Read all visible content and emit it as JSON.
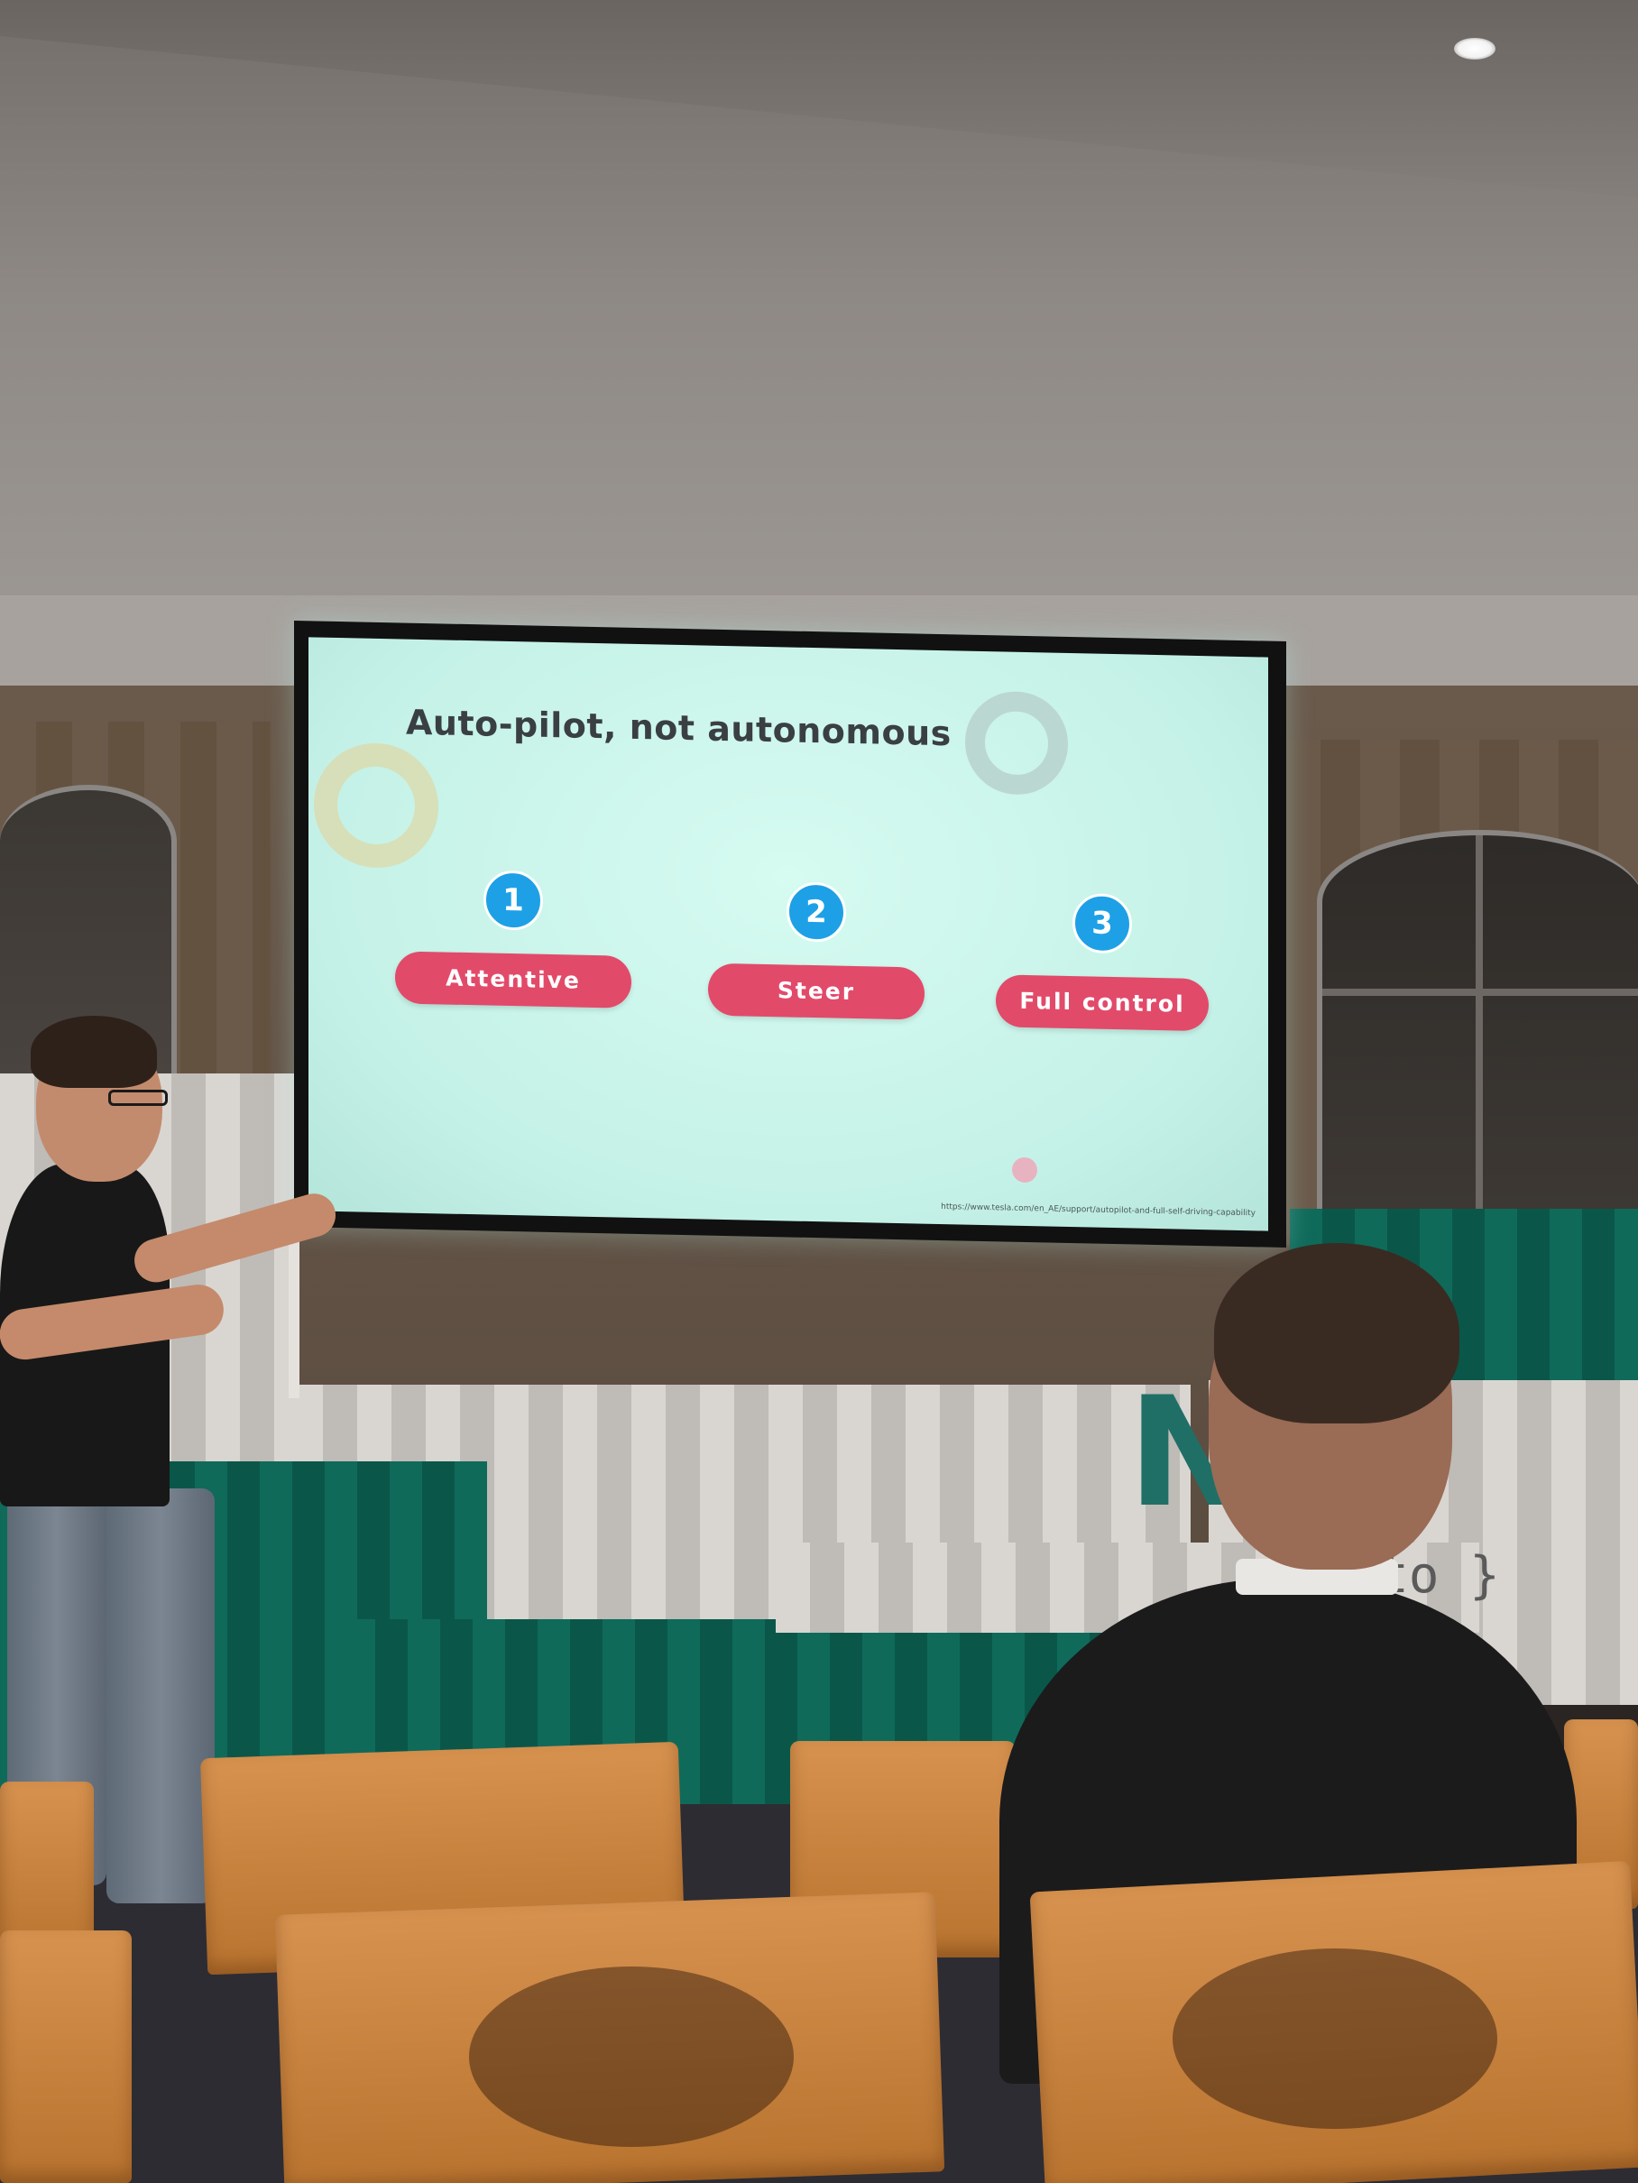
{
  "slide": {
    "title": "Auto-pilot, not autonomous",
    "steps": [
      {
        "number": "1",
        "label": "Attentive"
      },
      {
        "number": "2",
        "label": "Steer"
      },
      {
        "number": "3",
        "label": "Full control"
      }
    ],
    "source_url": "https://www.tesla.com/en_AE/support/autopilot-and-full-self-driving-capability"
  },
  "stage": {
    "logo_text": "NC",
    "logo_sub": "to }"
  },
  "colors": {
    "slide_background": "#c8f3ea",
    "step_badge": "#1ea0e6",
    "step_pill": "#e24a6a",
    "title_text": "#3a3f44",
    "stage_curtain_green": "#0f6a5a",
    "chair_wood": "#c98240"
  }
}
